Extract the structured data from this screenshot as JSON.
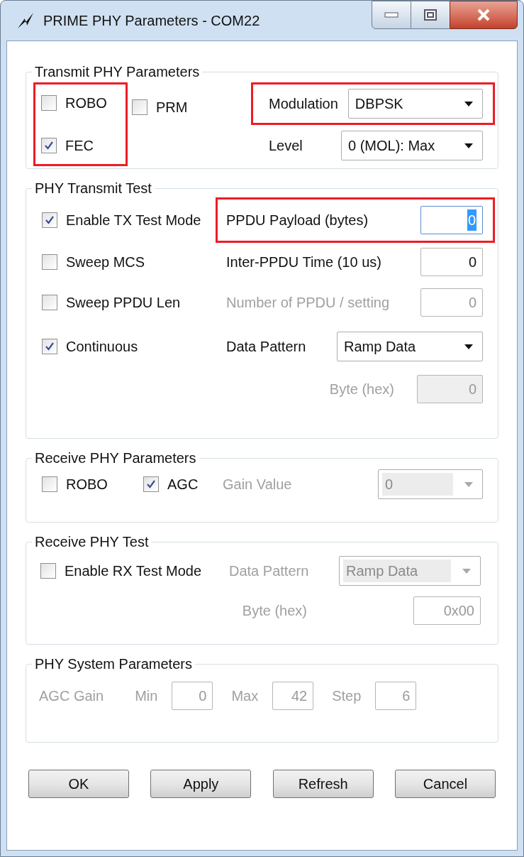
{
  "window": {
    "title": "PRIME PHY Parameters - COM22"
  },
  "transmit_phy": {
    "title": "Transmit PHY Parameters",
    "checkboxes_highlighted": true,
    "robo": {
      "label": "ROBO",
      "checked": false
    },
    "prm": {
      "label": "PRM",
      "checked": false
    },
    "fec": {
      "label": "FEC",
      "checked": true
    },
    "modulation": {
      "label": "Modulation",
      "value": "DBPSK",
      "highlighted": true
    },
    "level": {
      "label": "Level",
      "value": "0 (MOL): Max"
    }
  },
  "phy_transmit_test": {
    "title": "PHY Transmit Test",
    "enable_tx": {
      "label": "Enable TX Test Mode",
      "checked": true
    },
    "sweep_mcs": {
      "label": "Sweep MCS",
      "checked": false
    },
    "sweep_ppdu_len": {
      "label": "Sweep PPDU Len",
      "checked": false
    },
    "continuous": {
      "label": "Continuous",
      "checked": true
    },
    "ppdu_payload": {
      "label": "PPDU Payload (bytes)",
      "value": "0",
      "highlighted": true,
      "text_selected": true
    },
    "inter_ppdu_time": {
      "label": "Inter-PPDU Time (10 us)",
      "value": "0",
      "disabled": false
    },
    "number_of_ppdu": {
      "label": "Number of PPDU / setting",
      "value": "0",
      "disabled": true
    },
    "data_pattern": {
      "label": "Data Pattern",
      "value": "Ramp Data",
      "disabled": false
    },
    "byte_hex": {
      "label": "Byte (hex)",
      "value": "0",
      "disabled": true
    }
  },
  "receive_phy": {
    "title": "Receive PHY Parameters",
    "robo": {
      "label": "ROBO",
      "checked": false
    },
    "agc": {
      "label": "AGC",
      "checked": true
    },
    "gain_value": {
      "label": "Gain Value",
      "value": "0",
      "disabled": true
    }
  },
  "receive_phy_test": {
    "title": "Receive PHY Test",
    "enable_rx": {
      "label": "Enable RX Test Mode",
      "checked": false
    },
    "data_pattern": {
      "label": "Data Pattern",
      "value": "Ramp Data",
      "disabled": true
    },
    "byte_hex": {
      "label": "Byte (hex)",
      "value": "0x00",
      "disabled": true
    }
  },
  "phy_system": {
    "title": "PHY System Parameters",
    "disabled": true,
    "agc_gain": "AGC Gain",
    "fields": [
      {
        "label": "Min",
        "value": "0"
      },
      {
        "label": "Max",
        "value": "42"
      },
      {
        "label": "Step",
        "value": "6"
      }
    ]
  },
  "buttons": [
    "OK",
    "Apply",
    "Refresh",
    "Cancel"
  ]
}
